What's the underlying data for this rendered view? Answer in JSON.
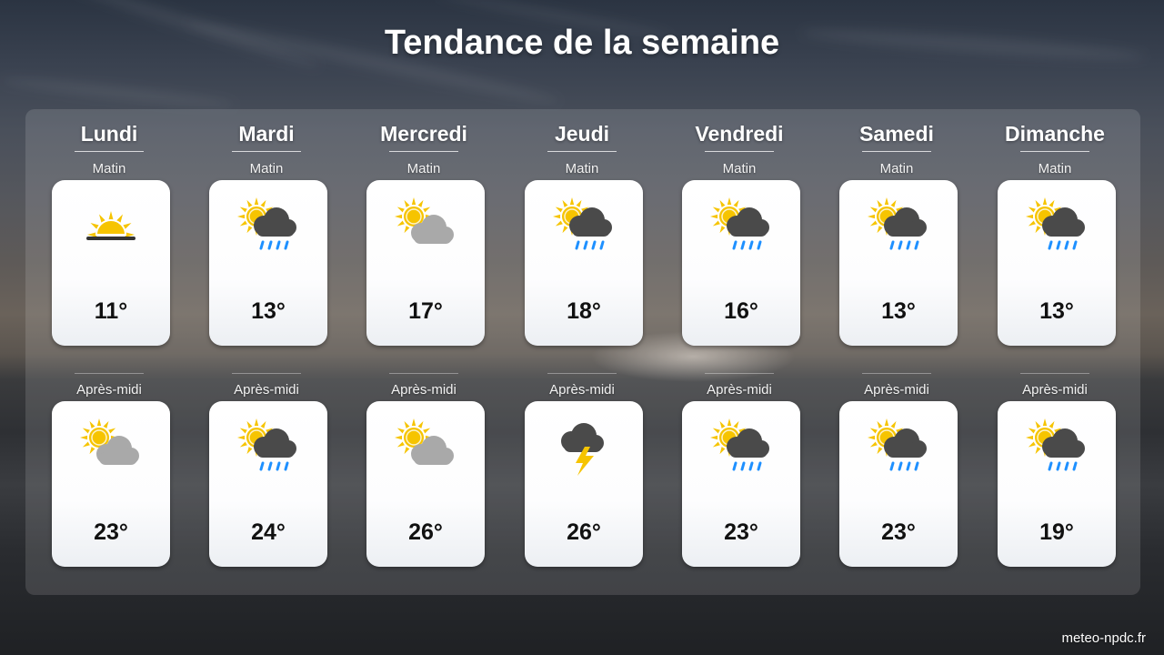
{
  "title": "Tendance de la semaine",
  "footer": "meteo-npdc.fr",
  "colors": {
    "sun": "#F6C400",
    "cloud_dark": "#4a4a4a",
    "cloud_light": "#a9a9a9",
    "rain": "#1E90FF"
  },
  "days": [
    {
      "name": "Lundi",
      "morning": {
        "label": "Matin",
        "temp": "11°",
        "icon": "sunrise-icon"
      },
      "afternoon": {
        "label": "Après-midi",
        "temp": "23°",
        "icon": "sun-cloud-icon"
      }
    },
    {
      "name": "Mardi",
      "morning": {
        "label": "Matin",
        "temp": "13°",
        "icon": "sun-rain-icon"
      },
      "afternoon": {
        "label": "Après-midi",
        "temp": "24°",
        "icon": "sun-rain-icon"
      }
    },
    {
      "name": "Mercredi",
      "morning": {
        "label": "Matin",
        "temp": "17°",
        "icon": "sun-cloud-icon"
      },
      "afternoon": {
        "label": "Après-midi",
        "temp": "26°",
        "icon": "sun-cloud-icon"
      }
    },
    {
      "name": "Jeudi",
      "morning": {
        "label": "Matin",
        "temp": "18°",
        "icon": "sun-rain-icon"
      },
      "afternoon": {
        "label": "Après-midi",
        "temp": "26°",
        "icon": "thunderstorm-icon"
      }
    },
    {
      "name": "Vendredi",
      "morning": {
        "label": "Matin",
        "temp": "16°",
        "icon": "sun-rain-icon"
      },
      "afternoon": {
        "label": "Après-midi",
        "temp": "23°",
        "icon": "sun-rain-icon"
      }
    },
    {
      "name": "Samedi",
      "morning": {
        "label": "Matin",
        "temp": "13°",
        "icon": "sun-rain-icon"
      },
      "afternoon": {
        "label": "Après-midi",
        "temp": "23°",
        "icon": "sun-rain-icon"
      }
    },
    {
      "name": "Dimanche",
      "morning": {
        "label": "Matin",
        "temp": "13°",
        "icon": "sun-rain-icon"
      },
      "afternoon": {
        "label": "Après-midi",
        "temp": "19°",
        "icon": "sun-rain-icon"
      }
    }
  ]
}
